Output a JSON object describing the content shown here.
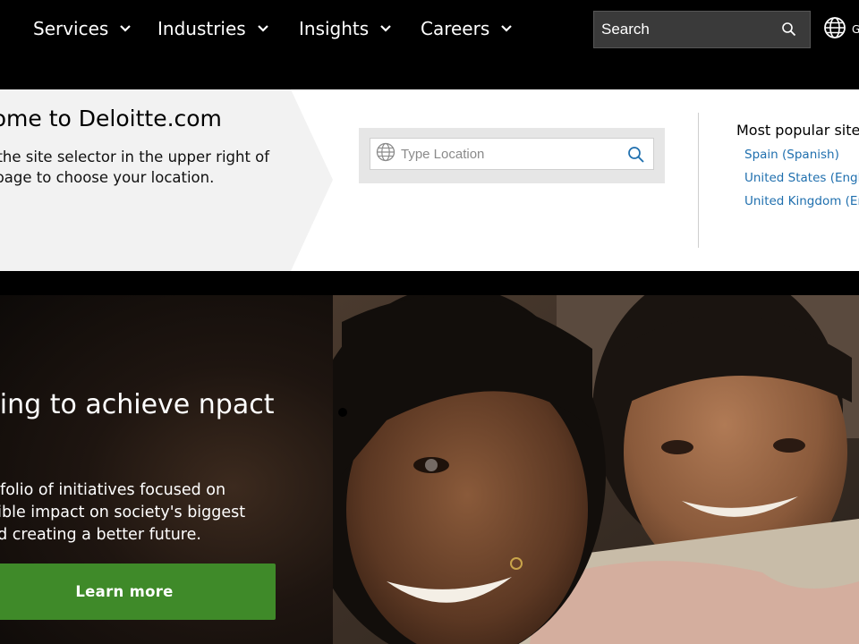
{
  "nav": {
    "items": [
      {
        "label": "Services"
      },
      {
        "label": "Industries"
      },
      {
        "label": "Insights"
      },
      {
        "label": "Careers"
      }
    ],
    "search_placeholder": "Search",
    "globe_label": "G"
  },
  "welcome": {
    "title": "come to Deloitte.com",
    "body": "use the site selector in the upper right of the page to choose your location.",
    "location_placeholder": "Type Location",
    "popular_title": "Most popular site",
    "popular_links": [
      {
        "label": "Spain (Spanish)"
      },
      {
        "label": "United States (Englis"
      },
      {
        "label": "United Kingdom (Eng"
      }
    ]
  },
  "hero": {
    "title": "ting to achieve npact",
    "description": "rtfolio of initiatives focused on gible impact on society's biggest nd creating a better future.",
    "cta_label": "Learn more"
  },
  "colors": {
    "nav_bg": "#000000",
    "link": "#1f6fae",
    "cta": "#3f8a29"
  }
}
